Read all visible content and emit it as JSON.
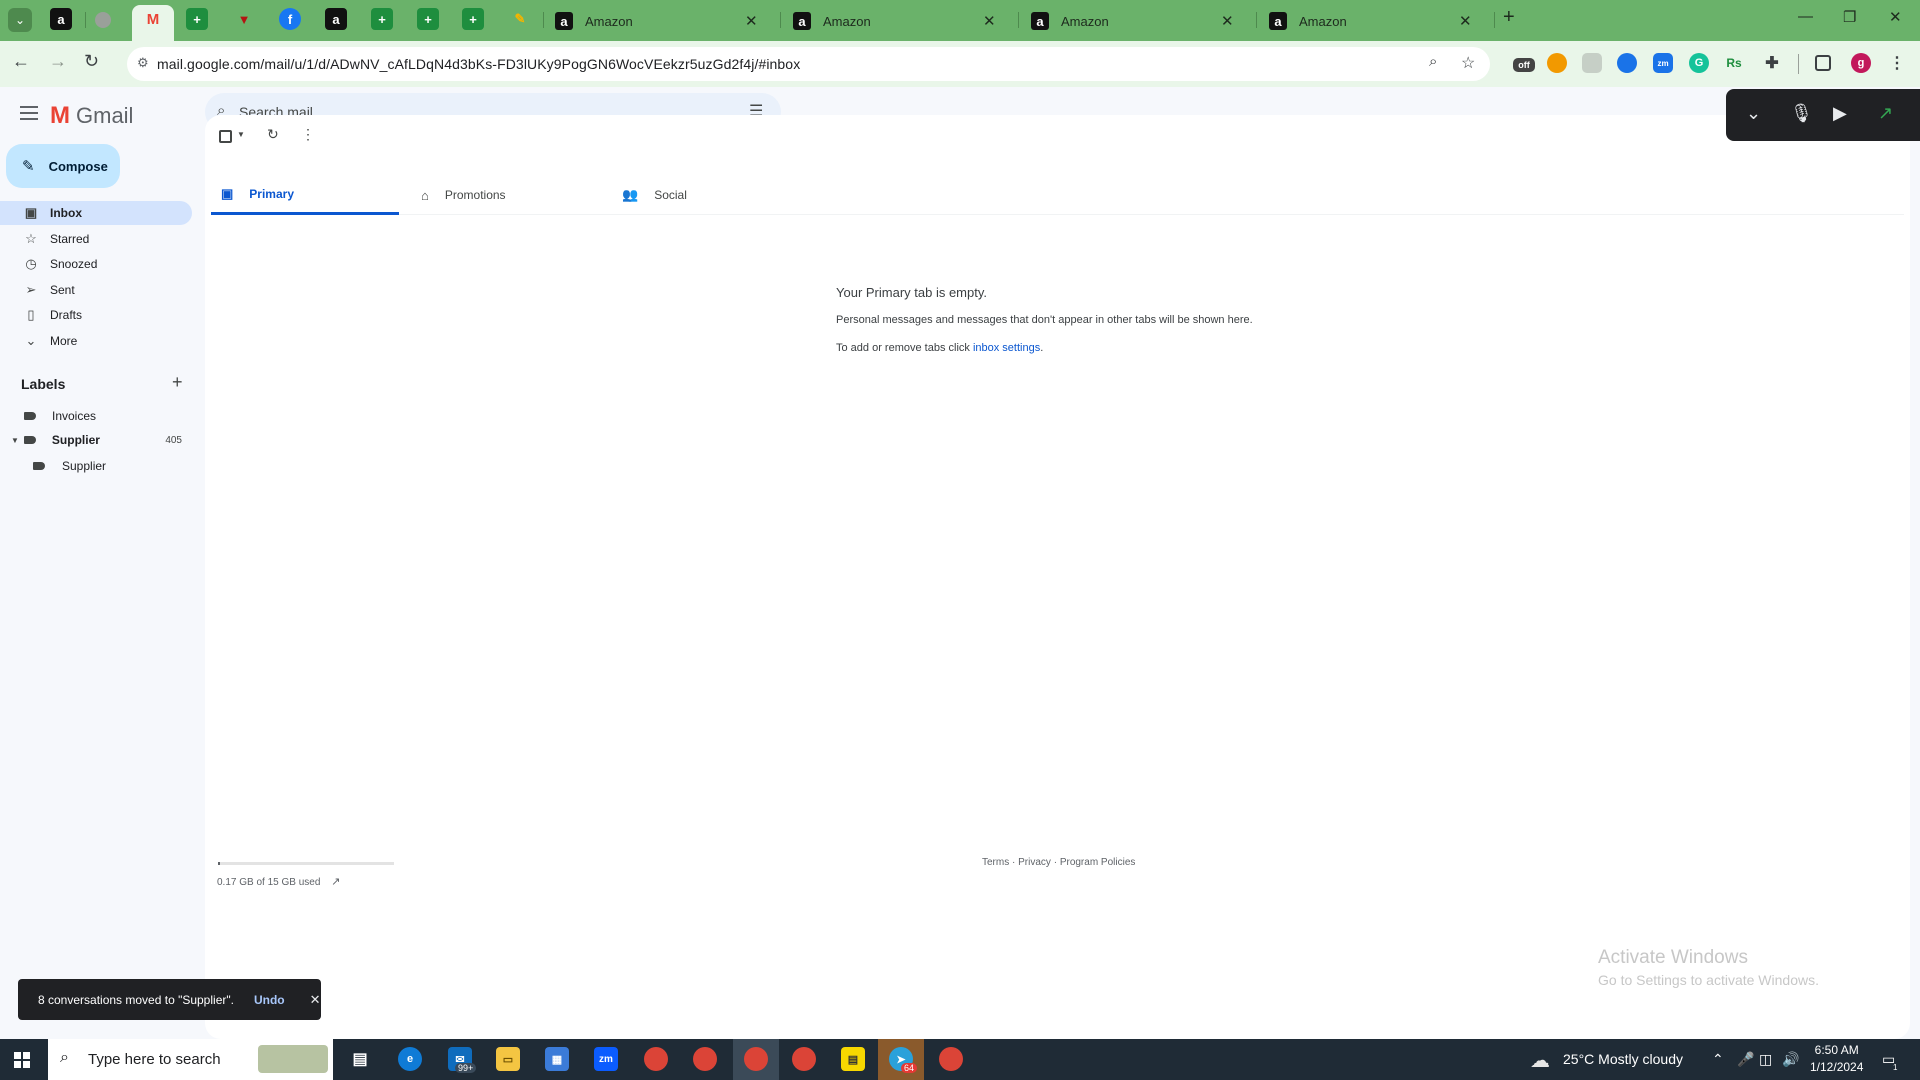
{
  "browser": {
    "tabs": [
      {
        "title": "Amazon"
      },
      {
        "title": "Amazon"
      },
      {
        "title": "Amazon"
      },
      {
        "title": "Amazon"
      }
    ],
    "url": "mail.google.com/mail/u/1/d/ADwNV_cAfLDqN4d3bKs-FD3lUKy9PogGN6WocVEekzr5uzGd2f4j/#inbox",
    "profile_initial": "g",
    "ext_badge": "off",
    "accent": "#6ab26a"
  },
  "gmail": {
    "app_name": "Gmail",
    "search_placeholder": "Search mail",
    "compose_label": "Compose",
    "nav": [
      {
        "label": "Inbox",
        "icon": "inbox-icon"
      },
      {
        "label": "Starred",
        "icon": "star-icon"
      },
      {
        "label": "Snoozed",
        "icon": "clock-icon"
      },
      {
        "label": "Sent",
        "icon": "send-icon"
      },
      {
        "label": "Drafts",
        "icon": "draft-icon"
      },
      {
        "label": "More",
        "icon": "chevron-down-icon"
      }
    ],
    "labels_heading": "Labels",
    "labels": [
      {
        "name": "Invoices",
        "count": ""
      },
      {
        "name": "Supplier",
        "count": "405"
      },
      {
        "name": "Supplier",
        "count": ""
      }
    ],
    "tabs": [
      {
        "label": "Primary",
        "icon": "inbox-icon"
      },
      {
        "label": "Promotions",
        "icon": "tag-icon"
      },
      {
        "label": "Social",
        "icon": "people-icon"
      }
    ],
    "empty": {
      "title": "Your Primary tab is empty.",
      "line1": "Personal messages and messages that don't appear in other tabs will be shown here.",
      "line2_prefix": "To add or remove tabs click ",
      "line2_link": "inbox settings",
      "line2_suffix": "."
    },
    "storage": "0.17 GB of 15 GB used",
    "storage_fraction": 0.011,
    "footer": {
      "terms": "Terms",
      "privacy": "Privacy",
      "policies": "Program Policies",
      "sep": " · "
    },
    "toast": {
      "message": "8 conversations moved to \"Supplier\".",
      "undo": "Undo"
    }
  },
  "windows": {
    "watermark_title": "Activate Windows",
    "watermark_sub": "Go to Settings to activate Windows.",
    "search_placeholder": "Type here to search",
    "mail_badge": "99+",
    "telegram_badge": "64",
    "weather": "25°C  Mostly cloudy",
    "time": "6:50 AM",
    "date": "1/12/2024",
    "notif_count": "1"
  }
}
